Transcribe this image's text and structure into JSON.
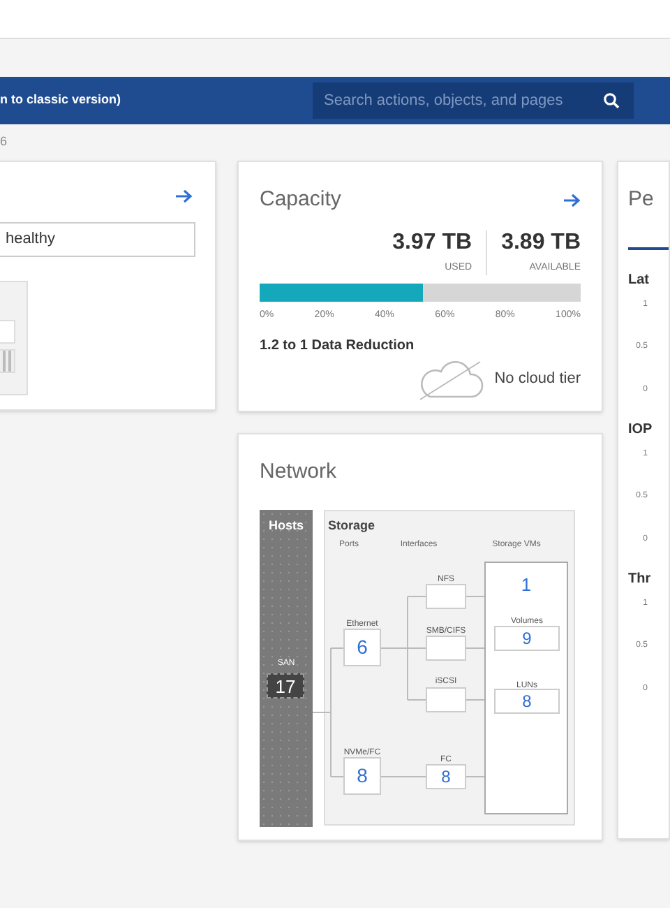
{
  "header": {
    "link_text": "n to classic version)",
    "search": {
      "placeholder": "Search actions, objects, and pages"
    }
  },
  "breadcrumb": "6",
  "health_card": {
    "status": "healthy"
  },
  "capacity": {
    "title": "Capacity",
    "used": {
      "value": "3.97 TB",
      "label": "USED"
    },
    "available": {
      "value": "3.89 TB",
      "label": "AVAILABLE"
    },
    "level": 0.51,
    "ticks": [
      "0%",
      "20%",
      "40%",
      "60%",
      "80%",
      "100%"
    ],
    "reduction": "1.2 to 1 Data Reduction",
    "cloud": "No cloud tier"
  },
  "network": {
    "title": "Network",
    "hosts": {
      "title": "Hosts",
      "label": "SAN",
      "count": "17"
    },
    "storage": {
      "title": "Storage",
      "columns": [
        "Ports",
        "Interfaces",
        "Storage VMs"
      ],
      "ports": [
        {
          "label": "Ethernet",
          "count": "6"
        },
        {
          "label": "NVMe/FC",
          "count": "8"
        }
      ],
      "interfaces": [
        {
          "label": "NFS"
        },
        {
          "label": "SMB/CIFS"
        },
        {
          "label": "iSCSI"
        },
        {
          "label": "FC",
          "count": "8"
        }
      ],
      "svms": {
        "count": "1",
        "items": [
          {
            "label": "Volumes",
            "count": "9"
          },
          {
            "label": "LUNs",
            "count": "8"
          }
        ]
      }
    }
  },
  "performance": {
    "title": "Pe",
    "tabs": [
      {
        "selected": true
      }
    ],
    "sections": [
      {
        "title": "Lat",
        "ticks": [
          "1",
          "0.5",
          "0"
        ]
      },
      {
        "title": "IOP",
        "ticks": [
          "1",
          "0.5",
          "0"
        ]
      },
      {
        "title": "Thr",
        "ticks": [
          "1",
          "0.5",
          "0"
        ]
      }
    ]
  }
}
